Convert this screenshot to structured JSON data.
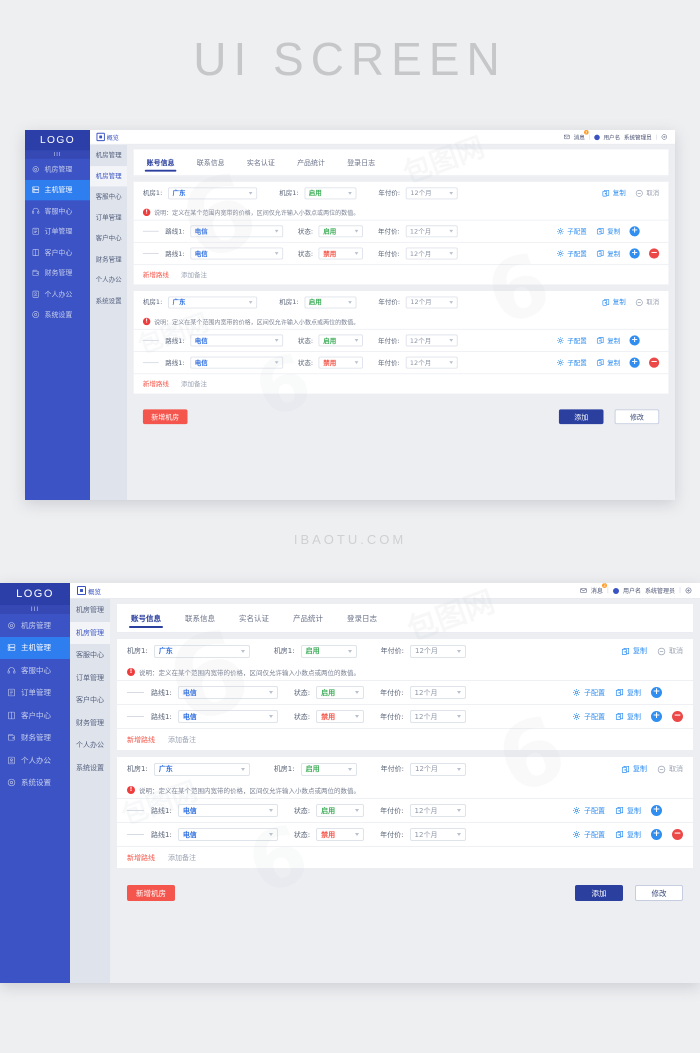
{
  "banner": {
    "title": "UI SCREEN"
  },
  "watermark": {
    "site": "IBAOTU.COM",
    "mark": "包图网"
  },
  "sidebar": {
    "logo": "LOGO",
    "logo_sub": "III",
    "items": [
      {
        "label": "机房管理",
        "icon": "gear-outline-icon",
        "active": false
      },
      {
        "label": "主机管理",
        "icon": "server-icon",
        "active": true
      },
      {
        "label": "客服中心",
        "icon": "headset-icon",
        "active": false
      },
      {
        "label": "订单管理",
        "icon": "order-icon",
        "active": false
      },
      {
        "label": "客户中心",
        "icon": "book-icon",
        "active": false
      },
      {
        "label": "财务管理",
        "icon": "wallet-icon",
        "active": false
      },
      {
        "label": "个人办公",
        "icon": "person-icon",
        "active": false
      },
      {
        "label": "系统设置",
        "icon": "settings-icon",
        "active": false
      }
    ]
  },
  "submenu": {
    "items": [
      {
        "label": "机房管理",
        "active": false
      },
      {
        "label": "机房管理",
        "active": true
      },
      {
        "label": "客服中心",
        "active": false
      },
      {
        "label": "订单管理",
        "active": false
      },
      {
        "label": "客户中心",
        "active": false
      },
      {
        "label": "财务管理",
        "active": false
      },
      {
        "label": "个人办公",
        "active": false
      },
      {
        "label": "系统设置",
        "active": false
      }
    ]
  },
  "topbar": {
    "breadcrumb": "概览",
    "message_label": "消息",
    "message_count": "3",
    "user_name": "用户名",
    "user_role": "系统管理员",
    "logout_icon": "logout-icon",
    "mail_icon": "mail-icon"
  },
  "tabs": [
    {
      "label": "账号信息",
      "active": true
    },
    {
      "label": "联系信息",
      "active": false
    },
    {
      "label": "实名认证",
      "active": false
    },
    {
      "label": "产品统计",
      "active": false
    },
    {
      "label": "登录日志",
      "active": false
    }
  ],
  "labels": {
    "room": "机房1:",
    "status": "状态:",
    "route": "路线1:",
    "year_price": "年付价:",
    "copy": "复制",
    "cancel": "取消",
    "sub_config": "子配置",
    "add_route": "新增路线",
    "add_note": "添加备注",
    "add_room": "新增机房",
    "submit": "添加",
    "modify": "修改",
    "plus": "+",
    "minus": "−"
  },
  "note": {
    "prefix": "说明：",
    "text": "定义在某个范围内宽带的价格，区间仅允许输入小数点或两位的数值。",
    "icon": "alert-icon"
  },
  "panels": [
    {
      "header": {
        "room_value": "广东",
        "status_value": "启用",
        "price_value": "12个月"
      },
      "routes": [
        {
          "route_value": "电信",
          "status_value": "启用",
          "status_kind": "green",
          "price_value": "12个月",
          "has_minus": false
        },
        {
          "route_value": "电信",
          "status_value": "禁用",
          "status_kind": "red",
          "price_value": "12个月",
          "has_minus": true
        }
      ]
    },
    {
      "header": {
        "room_value": "广东",
        "status_value": "启用",
        "price_value": "12个月"
      },
      "routes": [
        {
          "route_value": "电信",
          "status_value": "启用",
          "status_kind": "green",
          "price_value": "12个月",
          "has_minus": false
        },
        {
          "route_value": "电信",
          "status_value": "禁用",
          "status_kind": "red",
          "price_value": "12个月",
          "has_minus": true
        }
      ]
    }
  ],
  "colors": {
    "sidebar": "#3b53c4",
    "sidebar_active": "#2f7ef0",
    "accent_blue": "#2f8ef0",
    "navy": "#2b3f9e",
    "red": "#f4564d",
    "green": "#3fae5a"
  }
}
